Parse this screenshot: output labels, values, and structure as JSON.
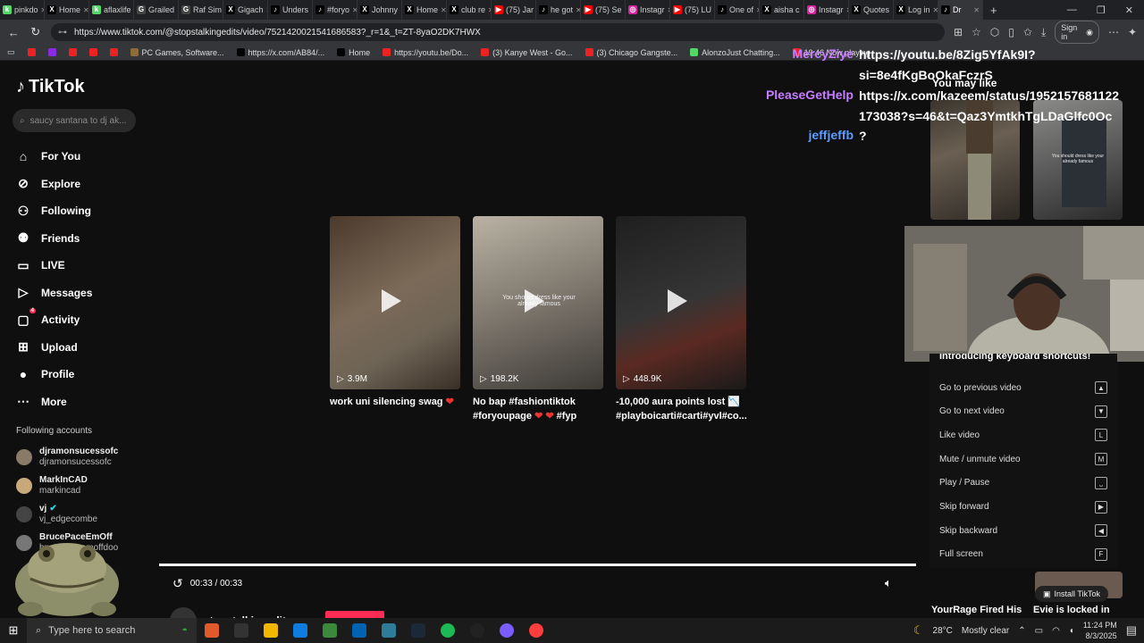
{
  "browser": {
    "tabs": [
      {
        "label": "pinkdo",
        "fav": "k",
        "color": "#53d769"
      },
      {
        "label": "Home",
        "fav": "X",
        "color": "#000000"
      },
      {
        "label": "aflaxlife",
        "fav": "k",
        "color": "#53d769"
      },
      {
        "label": "Grailed",
        "fav": "G",
        "color": "#444444"
      },
      {
        "label": "Raf Sim",
        "fav": "G",
        "color": "#444444"
      },
      {
        "label": "Gigach",
        "fav": "X",
        "color": "#000000"
      },
      {
        "label": "Unders",
        "fav": "♪",
        "color": "#000000"
      },
      {
        "label": "#foryo",
        "fav": "♪",
        "color": "#000000"
      },
      {
        "label": "Johnny",
        "fav": "X",
        "color": "#000000"
      },
      {
        "label": "Home",
        "fav": "X",
        "color": "#000000"
      },
      {
        "label": "club re",
        "fav": "X",
        "color": "#000000"
      },
      {
        "label": "(75) Jar",
        "fav": "▶",
        "color": "#ff0000"
      },
      {
        "label": "he got",
        "fav": "♪",
        "color": "#000000"
      },
      {
        "label": "(75) Se",
        "fav": "▶",
        "color": "#ff0000"
      },
      {
        "label": "Instagr",
        "fav": "◎",
        "color": "#d6249f"
      },
      {
        "label": "(75) LU",
        "fav": "▶",
        "color": "#ff0000"
      },
      {
        "label": "One of",
        "fav": "♪",
        "color": "#000000"
      },
      {
        "label": "aisha c",
        "fav": "X",
        "color": "#000000"
      },
      {
        "label": "Instagr",
        "fav": "◎",
        "color": "#d6249f"
      },
      {
        "label": "Quotes",
        "fav": "X",
        "color": "#000000"
      },
      {
        "label": "Log in",
        "fav": "X",
        "color": "#000000"
      },
      {
        "label": "Dr",
        "fav": "♪",
        "color": "#000000",
        "active": true
      }
    ],
    "url": "https://www.tiktok.com/@stopstalkingedits/video/7521420021541686583?_r=1&_t=ZT-8yaO2DK7HWX",
    "signin_label": "Sign in",
    "bookmarks": [
      {
        "label": "",
        "color": "#e22"
      },
      {
        "label": "",
        "color": "#8a2be2"
      },
      {
        "label": "",
        "color": "#e22"
      },
      {
        "label": "",
        "color": "#e22"
      },
      {
        "label": "",
        "color": "#e22"
      },
      {
        "label": "PC Games, Software...",
        "color": "#8a6d3b"
      },
      {
        "label": "https://x.com/AB84/...",
        "color": "#000000"
      },
      {
        "label": "Home",
        "color": "#000000"
      },
      {
        "label": "https://youtu.be/Do...",
        "color": "#e22"
      },
      {
        "label": "(3) Kanye West - Go...",
        "color": "#e22"
      },
      {
        "label": "(3) Chicago Gangste...",
        "color": "#e22"
      },
      {
        "label": "AlonzoJust Chatting...",
        "color": "#53d769"
      },
      {
        "label": "19:46 Now playing",
        "color": "#e22"
      }
    ]
  },
  "tiktok": {
    "logo": "TikTok",
    "search_placeholder": "saucy santana to dj ak...",
    "nav": [
      {
        "label": "For You",
        "icon": "⌂"
      },
      {
        "label": "Explore",
        "icon": "⊘"
      },
      {
        "label": "Following",
        "icon": "⚇"
      },
      {
        "label": "Friends",
        "icon": "⚉"
      },
      {
        "label": "LIVE",
        "icon": "▭"
      },
      {
        "label": "Messages",
        "icon": "▷"
      },
      {
        "label": "Activity",
        "icon": "▢",
        "badge": "4"
      },
      {
        "label": "Upload",
        "icon": "⊞"
      },
      {
        "label": "Profile",
        "icon": "●"
      },
      {
        "label": "More",
        "icon": "⋯"
      }
    ],
    "following_title": "Following accounts",
    "following": [
      {
        "name": "djramonsucessofc",
        "handle": "djramonsucessofc"
      },
      {
        "name": "MarkInCAD",
        "handle": "markincad"
      },
      {
        "name": "vj",
        "handle": "vj_edgecombe",
        "verified": true
      },
      {
        "name": "BrucePaceEmOff",
        "handle": "brucepaceemoffdoo"
      }
    ],
    "videos": [
      {
        "views": "3.9M",
        "caption": "work uni silencing swag",
        "heart": "❤"
      },
      {
        "views": "198.2K",
        "caption": "No bap #fashiontiktok #foryoupage",
        "heart": "❤ ❤",
        "caption_tail": " #fyp",
        "overlay": "You should dress like your already famous"
      },
      {
        "views": "448.9K",
        "caption": "-10,000 aura points lost 📉 #playboicarti#carti#yvl#co..."
      }
    ],
    "time": "00:33 / 00:33",
    "progress": 1.0,
    "author": "stopstalkingedits",
    "you_may_like": "You may like",
    "right_thumb_overlay": "You should dress like your already famous",
    "shortcuts_title": "Introducing keyboard shortcuts!",
    "shortcuts": [
      {
        "label": "Go to previous video",
        "key": "▲"
      },
      {
        "label": "Go to next video",
        "key": "▼"
      },
      {
        "label": "Like video",
        "key": "L"
      },
      {
        "label": "Mute / unmute video",
        "key": "M"
      },
      {
        "label": "Play / Pause",
        "key": "⎵"
      },
      {
        "label": "Skip forward",
        "key": "▶"
      },
      {
        "label": "Skip backward",
        "key": "◀"
      },
      {
        "label": "Full screen",
        "key": "F"
      }
    ],
    "install_label": "Install TikTok",
    "right_captions": [
      "YourRage Fired His",
      "Evie is locked in"
    ]
  },
  "chat": [
    {
      "name": "MercyZiye",
      "name_color": "#c77dff",
      "msg": "https://youtu.be/8Zig5YfAk9I?"
    },
    {
      "name": "",
      "name_color": "#ffffff",
      "msg": "si=8e4fKgBoOkaFczrS"
    },
    {
      "name": "PleaseGetHelp",
      "name_color": "#c77dff",
      "msg": "https://x.com/kazeem/status/1952157681122"
    },
    {
      "name": "",
      "name_color": "#ffffff",
      "msg": "173038?s=46&t=Qaz3YmtkhTgLDaGlfc0Oc"
    },
    {
      "name": "jeffjeffb",
      "name_color": "#5b9cff",
      "msg": "?"
    }
  ],
  "taskbar": {
    "search_placeholder": "Type here to search",
    "weather": "28°C",
    "weather_desc": "Mostly clear",
    "time": "11:24 PM",
    "date": "8/3/2025",
    "apps": [
      "#e05a2b",
      "#333333",
      "#f3b700",
      "#0f7de0",
      "#3b8a3b",
      "#0063b1",
      "#2d7d9a",
      "#1b2838",
      "#1db954",
      "#222222",
      "#7a5cff",
      "#ff3d3d"
    ]
  }
}
